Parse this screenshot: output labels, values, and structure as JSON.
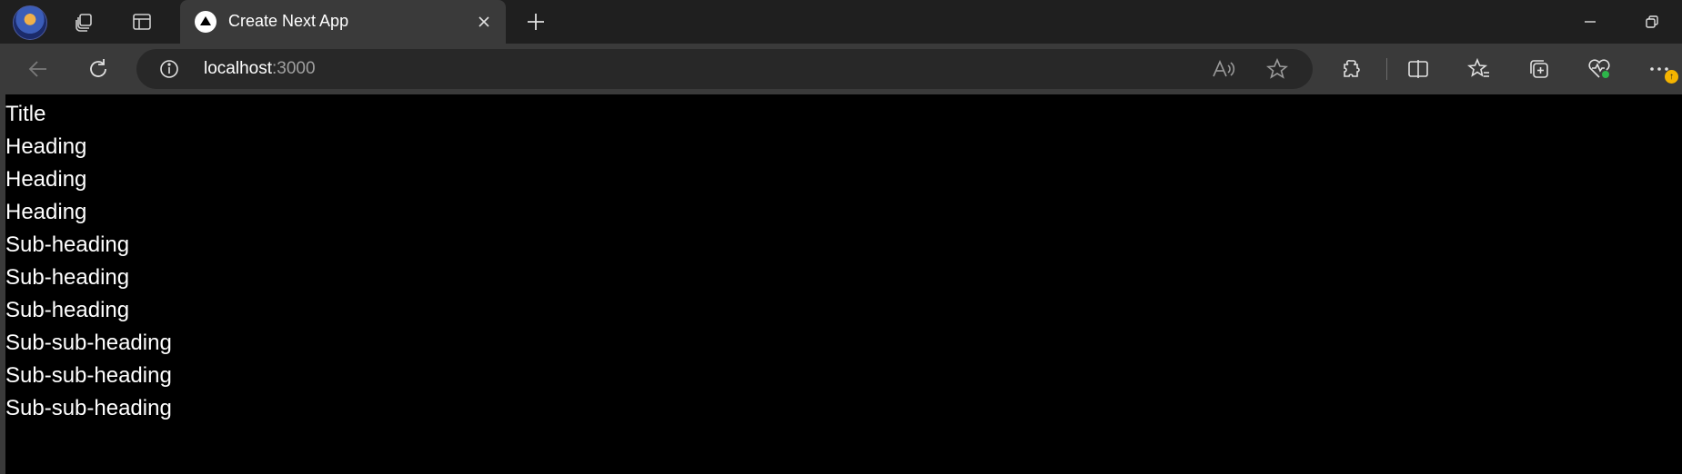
{
  "tab": {
    "title": "Create Next App",
    "favicon": "next-logo-icon"
  },
  "address": {
    "host": "localhost",
    "port": ":3000"
  },
  "page": {
    "title": "Title",
    "headings": [
      "Heading",
      "Heading",
      "Heading"
    ],
    "subheadings": [
      "Sub-heading",
      "Sub-heading",
      "Sub-heading"
    ],
    "subsubheadings": [
      "Sub-sub-heading",
      "Sub-sub-heading",
      "Sub-sub-heading"
    ]
  },
  "colors": {
    "tabstrip": "#1f1f1f",
    "toolbar": "#3a3a3a",
    "omnibox": "#282828",
    "page_background": "#000000",
    "page_text": "#ffffff",
    "notification_badge": "#f5b400",
    "health_dot": "#2db54a"
  },
  "icons": [
    "profile-avatar",
    "workspaces-icon",
    "vertical-tabs-icon",
    "next-logo-icon",
    "close-icon",
    "new-tab-icon",
    "minimize-icon",
    "restore-icon",
    "back-icon",
    "refresh-icon",
    "site-info-icon",
    "read-aloud-icon",
    "favorite-star-icon",
    "extensions-icon",
    "split-screen-icon",
    "favorites-icon",
    "collections-icon",
    "browser-essentials-icon",
    "more-menu-icon"
  ]
}
